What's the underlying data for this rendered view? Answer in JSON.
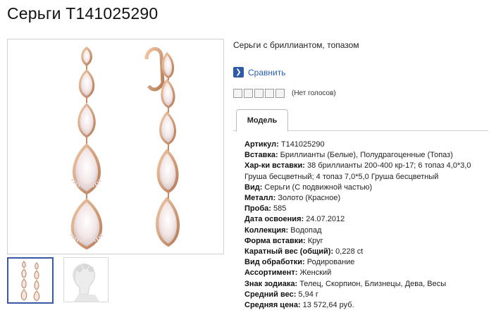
{
  "title": "Серьги Т141025290",
  "description": "Серьги с бриллиантом, топазом",
  "compare": {
    "label": "Сравнить",
    "icon": "chevron-right-icon"
  },
  "rating": {
    "stars": 5,
    "filled": 0,
    "votes_text": "(Нет голосов)"
  },
  "tabs": [
    {
      "label": "Модель",
      "active": true
    }
  ],
  "props": [
    {
      "key": "Артикул:",
      "value": " Т141025290"
    },
    {
      "key": "Вставка:",
      "value": " Бриллианты (Белые), Полудрагоценные (Топаз)"
    },
    {
      "key": "Хар-ки вставки:",
      "value": " 38 бриллианты 200-400 кр-17; 6 топаз 4,0*3,0 Груша бесцветный; 4 топаз 7,0*5,0 Груша бесцветный"
    },
    {
      "key": "Вид:",
      "value": " Серьги (С подвижной частью)"
    },
    {
      "key": "Металл:",
      "value": " Золото (Красное)"
    },
    {
      "key": "Проба:",
      "value": " 585"
    },
    {
      "key": "Дата освоения:",
      "value": " 24.07.2012"
    },
    {
      "key": "Коллекция:",
      "value": " Водопад"
    },
    {
      "key": "Форма вставки:",
      "value": " Круг"
    },
    {
      "key": "Каратный вес (общий):",
      "value": " 0,228 ct"
    },
    {
      "key": "Вид обработки:",
      "value": " Родирование"
    },
    {
      "key": "Ассортимент:",
      "value": " Женский"
    },
    {
      "key": "Знак зодиака:",
      "value": " Телец, Скорпион, Близнецы, Дева, Весы"
    },
    {
      "key": "Средний вес:",
      "value": " 5,94 г"
    },
    {
      "key": "Средняя цена:",
      "value": " 13 572,64 руб."
    }
  ],
  "colors": {
    "accent": "#2f5aa6",
    "link": "#2a5db0",
    "gold": "#d9a07a"
  }
}
